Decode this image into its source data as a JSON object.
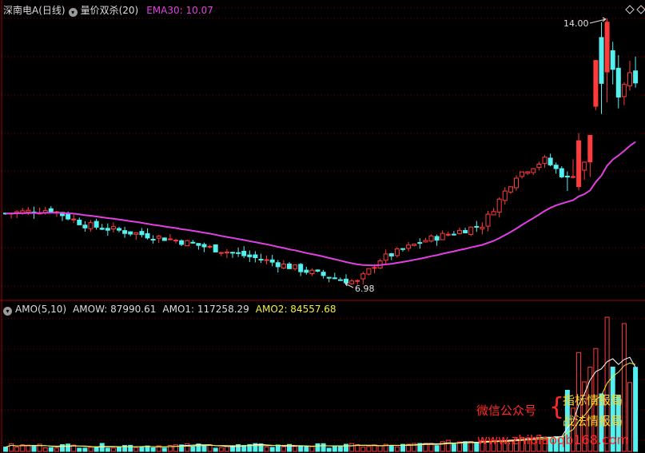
{
  "colors": {
    "bg": "#000000",
    "grid": "#7a0000",
    "up": "#ff3b3b",
    "down": "#54f0f0",
    "ema": "#e040e0",
    "header_text": "#dddddd",
    "ema_label": "#e040e0",
    "amo2": "#f0f040",
    "wm_red": "#ff2a2a",
    "wm_yellow": "#ffd42a"
  },
  "main_panel": {
    "stock_name": "深南电A(日线)",
    "indicator_label": "量价双杀(20)",
    "ema_label": "EMA30: 10.07",
    "high_marker": "14.00",
    "low_marker": "6.98",
    "settings_icon": "circle-dropdown-icon"
  },
  "sub_panel": {
    "title": "AMO(5,10)",
    "amow": "AMOW: 87990.61",
    "amo1": "AMO1: 117258.29",
    "amo2": "AMO2: 84557.68",
    "settings_icon": "circle-dropdown-icon"
  },
  "watermark": {
    "label": "微信公众号",
    "brace": "{",
    "line1": "指标情报局",
    "line2": "战法情报局",
    "url": "www.zhibiaoqb168.com"
  },
  "chart_data": [
    {
      "type": "candlestick",
      "title": "深南电A(日线)",
      "ylim": [
        6.5,
        14.5
      ],
      "y_gridlines": [
        14,
        13,
        12,
        11,
        10,
        9,
        8,
        7
      ],
      "annotations": [
        {
          "text": "14.00",
          "kind": "period-high"
        },
        {
          "text": "6.98",
          "kind": "period-low"
        }
      ],
      "series": [
        {
          "name": "EMA30",
          "last_value": 10.07
        }
      ]
    },
    {
      "type": "bar",
      "title": "AMO(5,10)",
      "series": [
        {
          "name": "AMOW",
          "last_value": 87990.61
        },
        {
          "name": "AMO1",
          "last_value": 117258.29
        },
        {
          "name": "AMO2",
          "last_value": 84557.68
        }
      ]
    }
  ]
}
